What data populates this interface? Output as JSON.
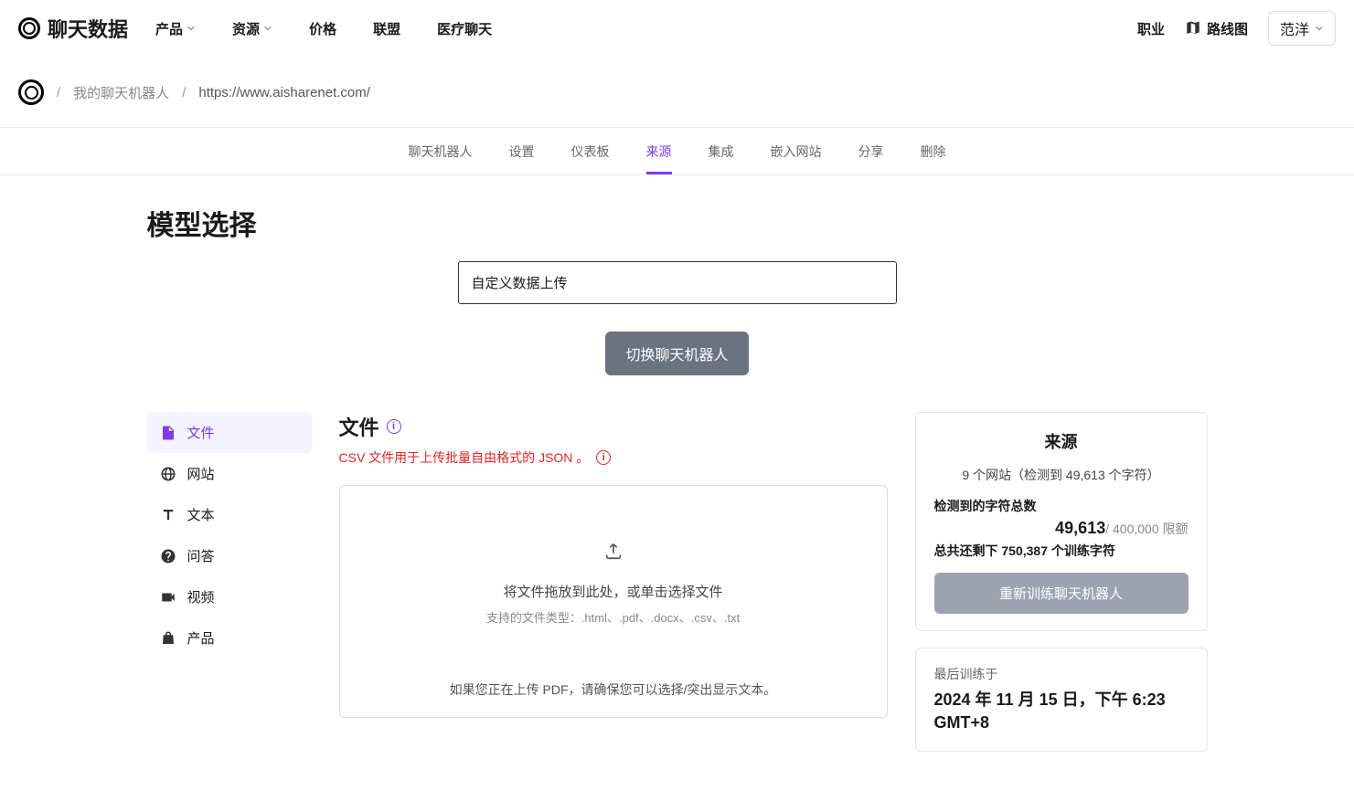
{
  "logo_text": "聊天数据",
  "nav": {
    "product": "产品",
    "resources": "资源",
    "pricing": "价格",
    "alliance": "联盟",
    "medical": "医疗聊天",
    "careers": "职业",
    "roadmap": "路线图",
    "user": "范洋"
  },
  "breadcrumb": {
    "my_chatbots": "我的聊天机器人",
    "current": "https://www.aisharenet.com/"
  },
  "tabs": {
    "chatbot": "聊天机器人",
    "settings": "设置",
    "dashboard": "仪表板",
    "sources": "来源",
    "integration": "集成",
    "embed": "嵌入网站",
    "share": "分享",
    "delete": "删除"
  },
  "page_title": "模型选择",
  "select_value": "自定义数据上传",
  "switch_btn": "切换聊天机器人",
  "sidebar": {
    "files": "文件",
    "website": "网站",
    "text": "文本",
    "qa": "问答",
    "video": "视频",
    "product": "产品"
  },
  "panel": {
    "title": "文件",
    "csv_note": "CSV 文件用于上传批量自由格式的 JSON 。",
    "upload_text": "将文件拖放到此处，或单击选择文件",
    "upload_sub": "支持的文件类型：.html、.pdf、.docx、.csv、.txt",
    "pdf_note": "如果您正在上传 PDF，请确保您可以选择/突出显示文本。"
  },
  "source_card": {
    "title": "来源",
    "detected": "9 个网站（检测到 49,613 个字符）",
    "total_label": "检测到的字符总数",
    "total_value": "49,613",
    "limit": "/ 400,000 限额",
    "remaining": "总共还剩下 750,387 个训练字符",
    "retrain_btn": "重新训练聊天机器人"
  },
  "last_trained": {
    "label": "最后训练于",
    "value": "2024 年 11 月 15 日，下午 6:23 GMT+8"
  }
}
